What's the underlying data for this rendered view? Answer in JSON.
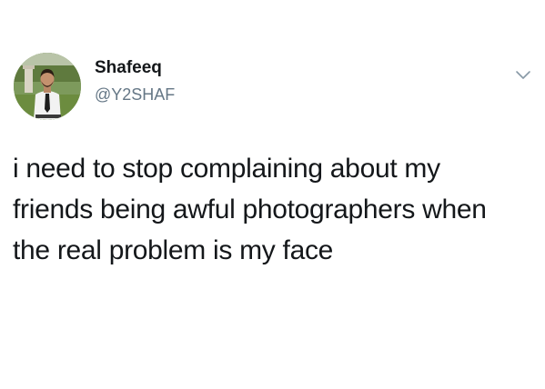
{
  "author": {
    "display_name": "Shafeeq",
    "handle": "@Y2SHAF",
    "avatar_icon": "profile-photo"
  },
  "menu": {
    "icon": "chevron-down-icon"
  },
  "tweet": {
    "lines": [
      "i need to stop complaining about my",
      "friends being awful photographers when",
      "the real problem is my face"
    ]
  },
  "colors": {
    "text": "#14171a",
    "secondary": "#657786",
    "background": "#ffffff"
  }
}
